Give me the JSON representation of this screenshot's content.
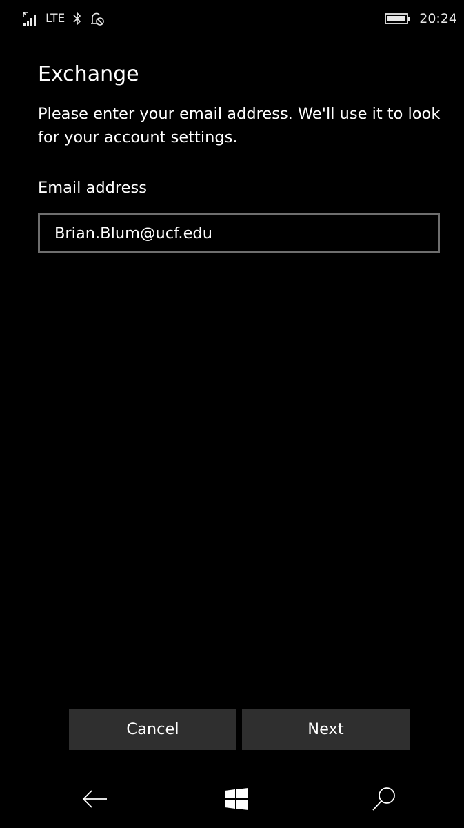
{
  "status_bar": {
    "network": "LTE",
    "time": "20:24",
    "icons": [
      "signal-icon",
      "bluetooth-icon",
      "quiet-hours-icon",
      "battery-icon"
    ]
  },
  "page": {
    "title": "Exchange",
    "instructions": "Please enter your email address. We'll use it to look for your account settings."
  },
  "email": {
    "label": "Email address",
    "value": "Brian.Blum@ucf.edu"
  },
  "buttons": {
    "cancel": "Cancel",
    "next": "Next"
  },
  "nav_bar": {
    "icons": [
      "back-arrow-icon",
      "windows-start-icon",
      "search-icon"
    ]
  },
  "colors": {
    "background": "#000000",
    "text": "#ffffff",
    "button_bg": "#2f2f2f",
    "input_border": "#6e6e6e"
  }
}
